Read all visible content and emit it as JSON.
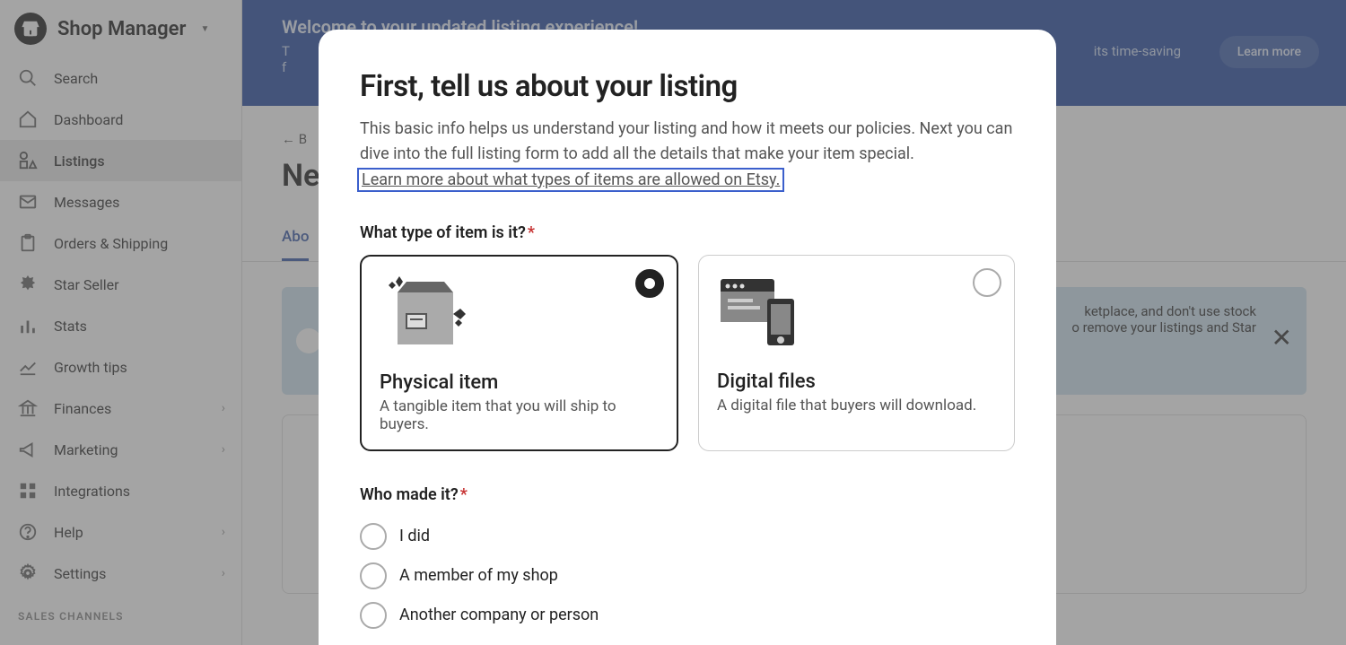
{
  "sidebar": {
    "title": "Shop Manager",
    "items": [
      {
        "label": "Search"
      },
      {
        "label": "Dashboard"
      },
      {
        "label": "Listings"
      },
      {
        "label": "Messages"
      },
      {
        "label": "Orders & Shipping"
      },
      {
        "label": "Star Seller"
      },
      {
        "label": "Stats"
      },
      {
        "label": "Growth tips"
      },
      {
        "label": "Finances"
      },
      {
        "label": "Marketing"
      },
      {
        "label": "Integrations"
      },
      {
        "label": "Help"
      },
      {
        "label": "Settings"
      }
    ],
    "section_label": "SALES CHANNELS"
  },
  "banner": {
    "title": "Welcome to your updated listing experience!",
    "text_1": "T",
    "text_2": "its time-saving",
    "text_3": "f",
    "learn_more": "Learn more"
  },
  "page": {
    "back": "B",
    "title": "Ne",
    "tab_about": "Abo",
    "info_text_1": "ketplace, and don't use stock",
    "info_text_2": "o remove your listings and Star"
  },
  "modal": {
    "title": "First, tell us about your listing",
    "desc": "This basic info helps us understand your listing and how it meets our policies. Next you can dive into the full listing form to add all the details that make your item special.",
    "link": "Learn more about what types of items are allowed on Etsy.",
    "q_type": "What type of item is it?",
    "type_physical": {
      "title": "Physical item",
      "desc": "A tangible item that you will ship to buyers."
    },
    "type_digital": {
      "title": "Digital files",
      "desc": "A digital file that buyers will download."
    },
    "q_who": "Who made it?",
    "who_options": [
      {
        "label": "I did"
      },
      {
        "label": "A member of my shop"
      },
      {
        "label": "Another company or person"
      }
    ]
  }
}
